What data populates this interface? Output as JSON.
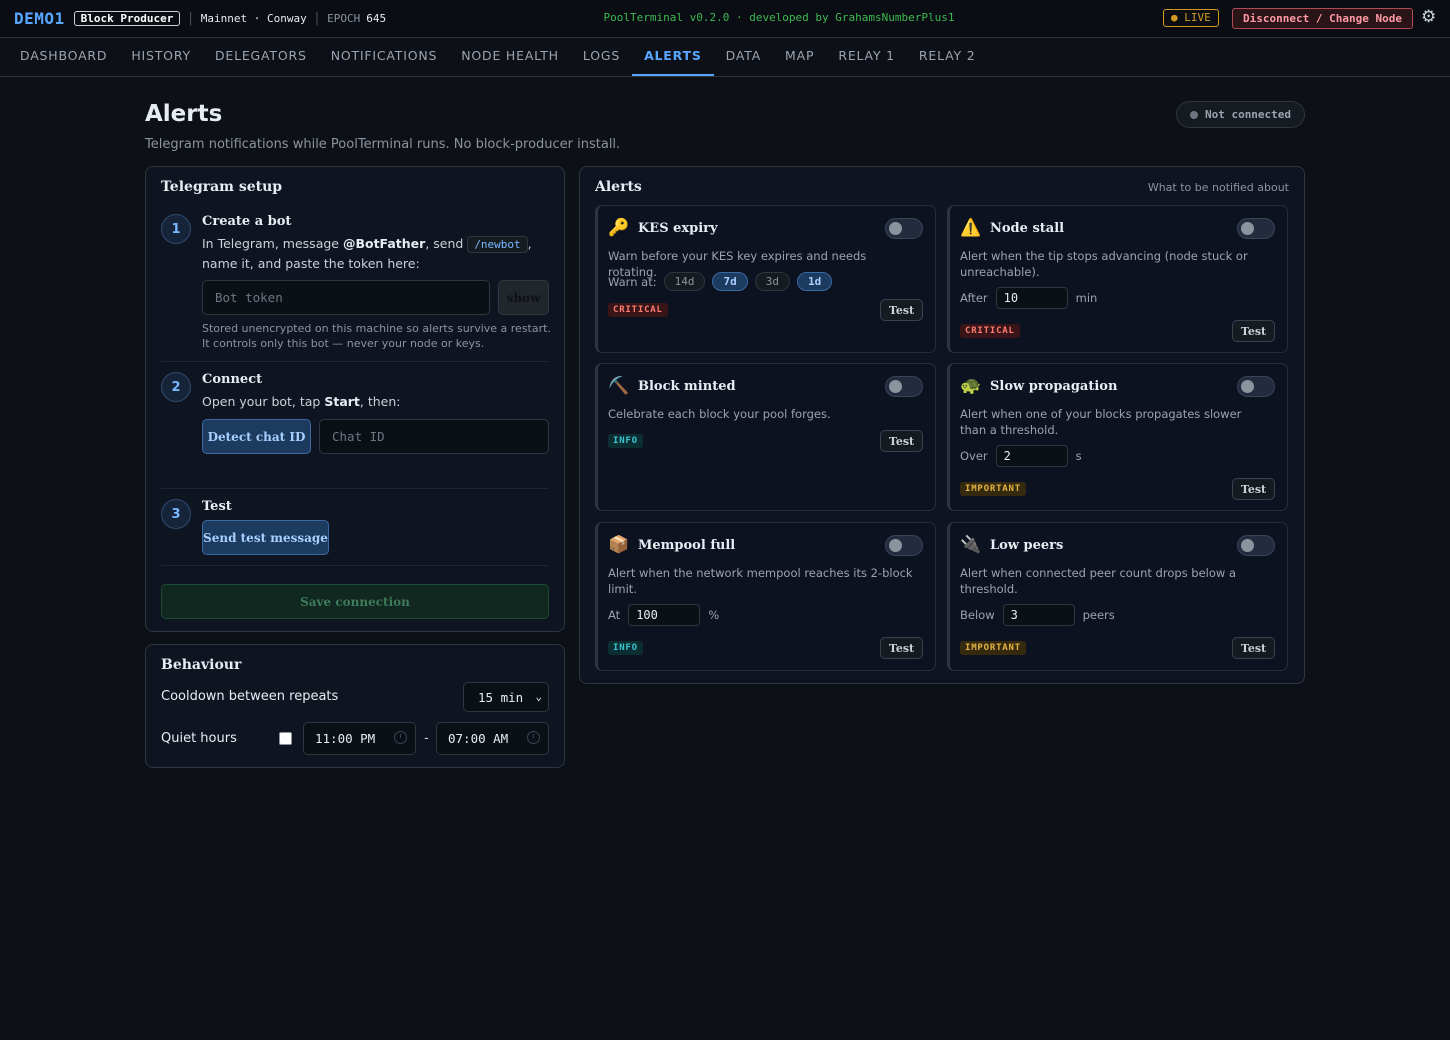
{
  "topbar": {
    "brand": "DEMO1",
    "role": "Block Producer",
    "network": "Mainnet · Conway",
    "epoch_label": "EPOCH",
    "epoch_value": "645",
    "app_title": "PoolTerminal v0.2.0 · developed by GrahamsNumberPlus1",
    "live_label": "● LIVE",
    "disconnect_label": "Disconnect / Change Node",
    "settings_icon": "gear-icon"
  },
  "nav": {
    "items": [
      "DASHBOARD",
      "HISTORY",
      "DELEGATORS",
      "NOTIFICATIONS",
      "NODE HEALTH",
      "LOGS",
      "ALERTS",
      "DATA",
      "MAP",
      "RELAY 1",
      "RELAY 2"
    ],
    "active": "ALERTS"
  },
  "header": {
    "title": "Alerts",
    "subtitle": "Telegram notifications while PoolTerminal runs. No block-producer install.",
    "status": "Not connected"
  },
  "telegram": {
    "title": "Telegram setup",
    "step1": {
      "num": "1",
      "title": "Create a bot",
      "text_a": "In Telegram, message ",
      "text_bold": "@BotFather",
      "text_b": ", send ",
      "code": "/newbot",
      "text_c": ",",
      "text_d": "name it, and paste the token here:",
      "token_placeholder": "Bot token",
      "show_label": "show",
      "note": "Stored unencrypted on this machine so alerts survive a restart. It controls only this bot — never your node or keys."
    },
    "step2": {
      "num": "2",
      "title": "Connect",
      "text_a": "Open your bot, tap ",
      "text_bold": "Start",
      "text_b": ", then:",
      "detect_label": "Detect chat ID",
      "chat_placeholder": "Chat ID"
    },
    "step3": {
      "num": "3",
      "title": "Test",
      "send_label": "Send test message"
    },
    "save_label": "Save connection"
  },
  "behaviour": {
    "title": "Behaviour",
    "cooldown_label": "Cooldown between repeats",
    "cooldown_value": "15 min",
    "quiet_label": "Quiet hours",
    "quiet_enabled": false,
    "quiet_start": "11:00 PM",
    "quiet_end": "07:00 AM",
    "quiet_sep": "-"
  },
  "alerts": {
    "title": "Alerts",
    "hint": "What to be notified about",
    "cards": [
      {
        "icon": "🔑",
        "icon_name": "key-icon",
        "title": "KES expiry",
        "desc": "Warn before your KES key expires and needs rotating.",
        "row_label": "Warn at:",
        "chips": [
          "14d",
          "7d",
          "3d",
          "1d"
        ],
        "chips_on": [
          false,
          true,
          false,
          true
        ],
        "severity": "CRITICAL",
        "test_label": "Test",
        "enabled": false
      },
      {
        "icon": "⚠️",
        "icon_name": "warning-icon",
        "title": "Node stall",
        "desc": "Alert when the tip stops advancing (node stuck or unreachable).",
        "row_label": "After",
        "value": "10",
        "unit": "min",
        "severity": "CRITICAL",
        "test_label": "Test",
        "enabled": false
      },
      {
        "icon": "⛏️",
        "icon_name": "pickaxe-icon",
        "title": "Block minted",
        "desc": "Celebrate each block your pool forges.",
        "severity": "INFO",
        "test_label": "Test",
        "enabled": false
      },
      {
        "icon": "🐢",
        "icon_name": "turtle-icon",
        "title": "Slow propagation",
        "desc": "Alert when one of your blocks propagates slower than a threshold.",
        "row_label": "Over",
        "value": "2",
        "unit": "s",
        "severity": "IMPORTANT",
        "test_label": "Test",
        "enabled": false
      },
      {
        "icon": "📦",
        "icon_name": "package-icon",
        "title": "Mempool full",
        "desc": "Alert when the network mempool reaches its 2-block limit.",
        "row_label": "At",
        "value": "100",
        "unit": "%",
        "severity": "INFO",
        "test_label": "Test",
        "enabled": false
      },
      {
        "icon": "🔌",
        "icon_name": "plug-icon",
        "title": "Low peers",
        "desc": "Alert when connected peer count drops below a threshold.",
        "row_label": "Below",
        "value": "3",
        "unit": "peers",
        "severity": "IMPORTANT",
        "test_label": "Test",
        "enabled": false
      }
    ]
  }
}
